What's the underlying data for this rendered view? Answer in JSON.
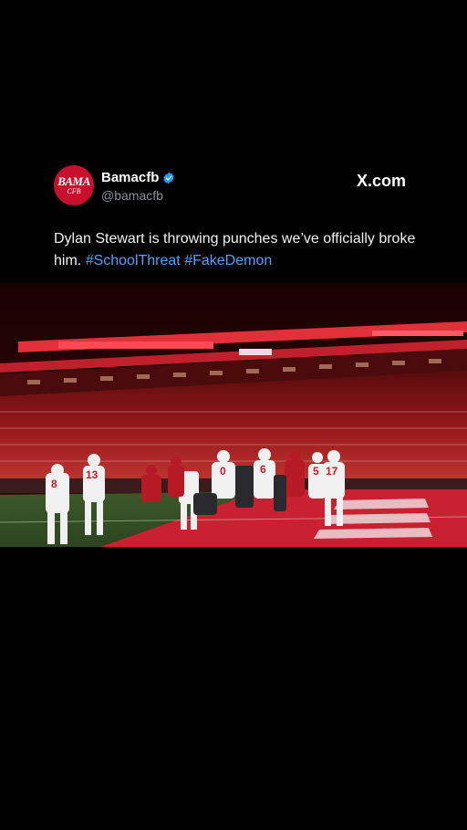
{
  "tweet": {
    "display_name": "Bamacfb",
    "handle": "@bamacfb",
    "avatar_text_top": "BAMA",
    "avatar_text_bottom": "CFB",
    "brand": "X.com",
    "text_main": "Dylan Stewart is throwing punches we’ve officially broke him.",
    "hashtags": [
      "#SchoolThreat",
      "#FakeDemon"
    ]
  },
  "media": {
    "jersey_numbers": [
      "8",
      "13",
      "0",
      "6",
      "5",
      "17"
    ]
  },
  "colors": {
    "background": "#000000",
    "verified": "#1d9bf0",
    "hashtag": "#4da3ff",
    "avatar": "#c8102e"
  },
  "icons": [
    "verified-badge-icon",
    "x-logo-icon"
  ]
}
